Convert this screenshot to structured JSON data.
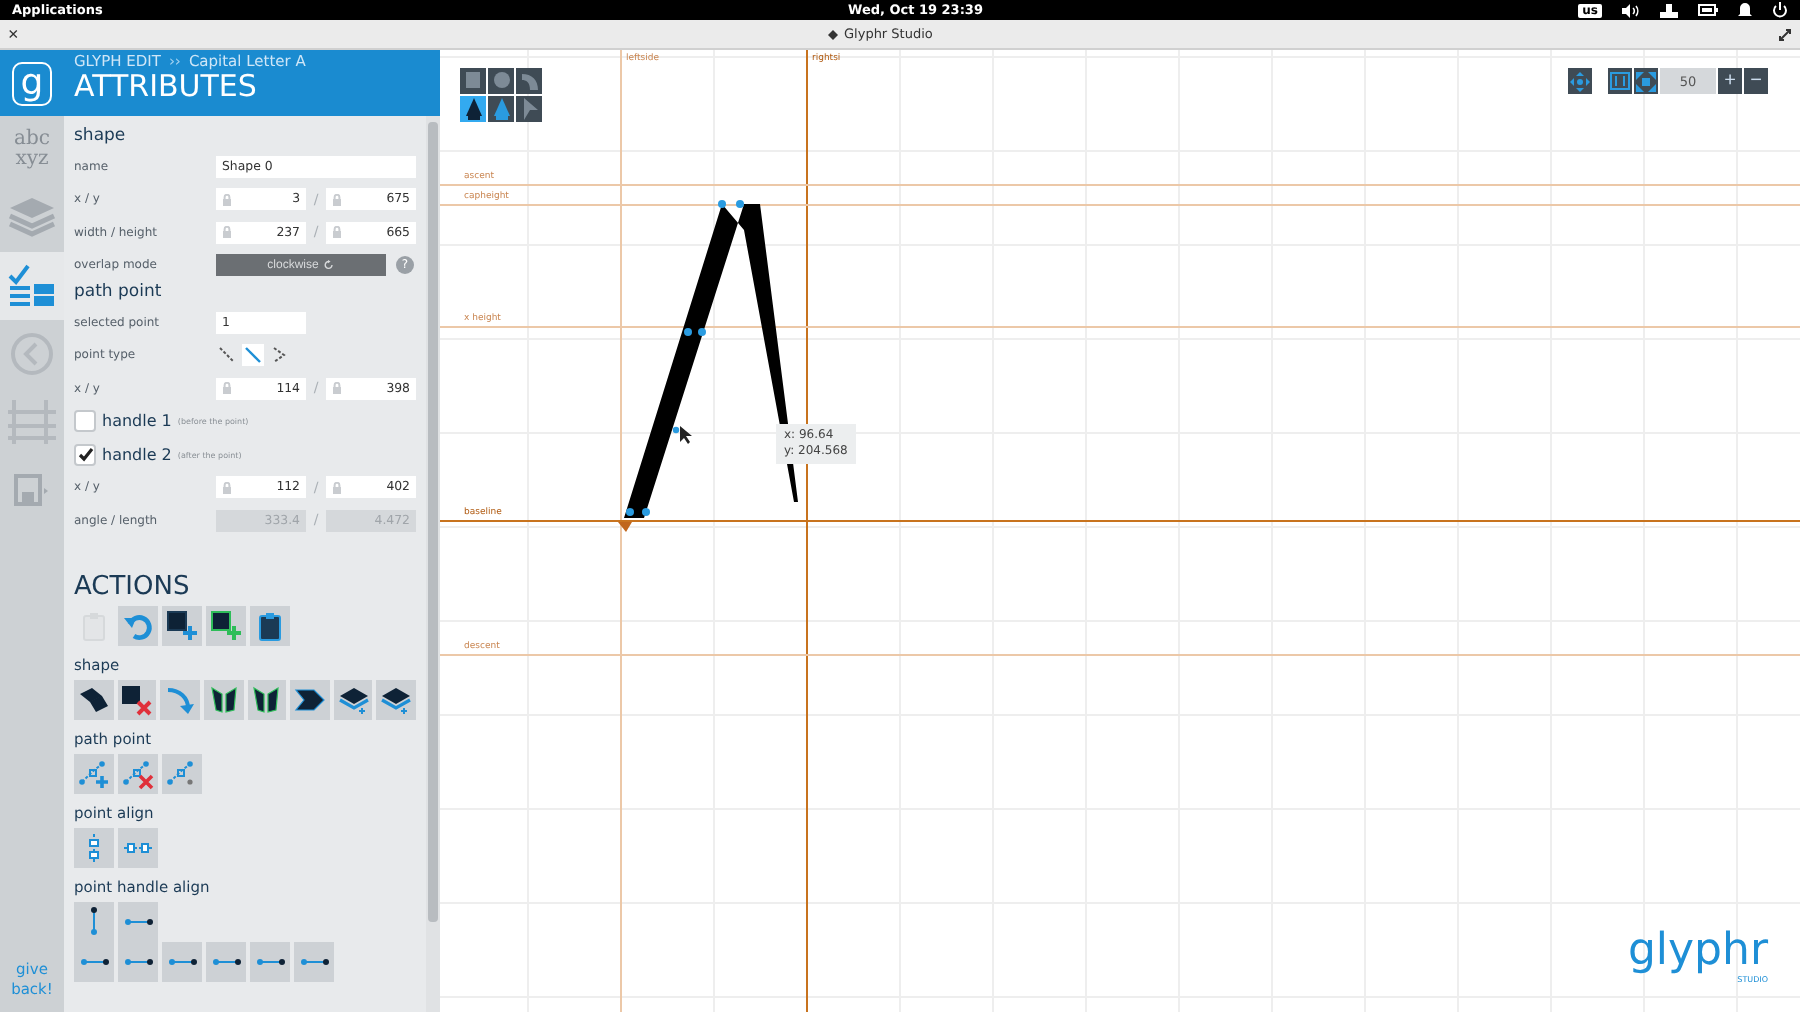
{
  "top_bar": {
    "menu": "Applications",
    "clock": "Wed, Oct 19  23:39",
    "keyboard": "us"
  },
  "window": {
    "title": "Glyphr Studio",
    "close": "×"
  },
  "nav": {
    "logo": "g",
    "items": [
      {
        "kind": "chars",
        "label": "abc xyz",
        "selected": false
      },
      {
        "kind": "layers",
        "selected": false
      },
      {
        "kind": "attributes",
        "selected": true
      },
      {
        "kind": "history",
        "selected": false
      },
      {
        "kind": "guides",
        "selected": false
      },
      {
        "kind": "save",
        "selected": false
      }
    ],
    "give_back": "give back!"
  },
  "header": {
    "breadcrumb": "GLYPH EDIT",
    "separator": "››",
    "glyph": "Capital Letter A",
    "title": "ATTRIBUTES"
  },
  "sections": [
    {
      "title": "shape",
      "rows": [
        {
          "kind": "text",
          "label": "name",
          "value": "Shape 0"
        },
        {
          "kind": "pair",
          "label": "x / y",
          "separator": "/",
          "values": [
            "3",
            "675"
          ],
          "disabled": false
        },
        {
          "kind": "pair",
          "label": "width / height",
          "separator": "/",
          "values": [
            "237",
            "665"
          ],
          "disabled": false
        },
        {
          "kind": "mode",
          "label": "overlap mode",
          "value": "clockwise",
          "help": "?"
        }
      ]
    },
    {
      "title": "path point",
      "rows": [
        {
          "kind": "number",
          "label": "selected point",
          "value": "1"
        },
        {
          "kind": "pointtype",
          "label": "point type",
          "options": [
            {
              "selected": false
            },
            {
              "selected": true
            },
            {
              "selected": false
            }
          ]
        },
        {
          "kind": "pair",
          "label": "x / y",
          "separator": "/",
          "values": [
            "114",
            "398"
          ],
          "disabled": false
        },
        {
          "kind": "check",
          "label": "handle 1",
          "note": "(before the point)",
          "checked": false
        },
        {
          "kind": "check",
          "label": "handle 2",
          "note": "(after the point)",
          "checked": true
        },
        {
          "kind": "pair",
          "label": "x / y",
          "separator": "/",
          "values": [
            "112",
            "402"
          ],
          "disabled": false
        },
        {
          "kind": "pair",
          "label": "angle / length",
          "separator": "/",
          "values": [
            "333.4",
            "4.472"
          ],
          "disabled": true
        }
      ]
    }
  ],
  "actions": {
    "title": "ACTIONS",
    "groups": [
      {
        "buttons": [
          {
            "kind": "clipboard",
            "disabled": true
          },
          {
            "kind": "undo",
            "disabled": false
          },
          {
            "kind": "square-plus",
            "disabled": false
          },
          {
            "kind": "square-plus-green",
            "disabled": false
          },
          {
            "kind": "clipboard-fill",
            "disabled": false
          }
        ]
      },
      {
        "title": "shape",
        "buttons": [
          {
            "kind": "squares",
            "disabled": false
          },
          {
            "kind": "square-x",
            "disabled": false
          },
          {
            "kind": "curve-arrow",
            "disabled": false
          },
          {
            "kind": "flip",
            "disabled": false
          },
          {
            "kind": "flip",
            "disabled": false
          },
          {
            "kind": "wedge",
            "disabled": false
          },
          {
            "kind": "layer-up",
            "disabled": false
          },
          {
            "kind": "layer-down",
            "disabled": false
          }
        ]
      },
      {
        "title": "path point",
        "buttons": [
          {
            "kind": "point-plus",
            "disabled": false
          },
          {
            "kind": "point-x",
            "disabled": false
          },
          {
            "kind": "points",
            "disabled": false
          }
        ]
      },
      {
        "title": "point align",
        "buttons": [
          {
            "kind": "align-v",
            "disabled": false
          },
          {
            "kind": "align-h",
            "disabled": false
          }
        ]
      },
      {
        "title": "point handle align",
        "buttons": [
          {
            "kind": "handle-v",
            "disabled": false
          },
          {
            "kind": "handle-h",
            "disabled": false
          }
        ]
      },
      {
        "buttons": [
          {
            "kind": "handle-h",
            "disabled": false
          },
          {
            "kind": "handle-h",
            "disabled": false
          },
          {
            "kind": "handle-h",
            "disabled": false
          },
          {
            "kind": "handle-h",
            "disabled": false
          },
          {
            "kind": "handle-h",
            "disabled": false
          },
          {
            "kind": "handle-h",
            "disabled": false
          }
        ]
      }
    ]
  },
  "canvas": {
    "tools": [
      {
        "kind": "square",
        "selected": false
      },
      {
        "kind": "circle",
        "selected": false
      },
      {
        "kind": "path",
        "selected": false
      },
      {
        "kind": "pen",
        "selected": true
      },
      {
        "kind": "pen-plus",
        "selected": false
      },
      {
        "kind": "arrow",
        "selected": false
      }
    ],
    "zoom": {
      "value": "50",
      "plus": "+",
      "minus": "−"
    },
    "vertical_guides": [
      {
        "label": "leftside",
        "strong": false
      },
      {
        "label": "rightsi",
        "strong": true
      }
    ],
    "horizontal_guides": [
      {
        "label": "ascent",
        "strong": false
      },
      {
        "label": "capheight",
        "strong": false
      },
      {
        "label": "x height",
        "strong": false
      },
      {
        "label": "baseline",
        "strong": true
      },
      {
        "label": "descent",
        "strong": false
      }
    ],
    "tooltip": [
      "x: 96.64",
      "y: 204.568"
    ],
    "logo": {
      "name": "glyphr",
      "sub": "STUDIO"
    }
  }
}
